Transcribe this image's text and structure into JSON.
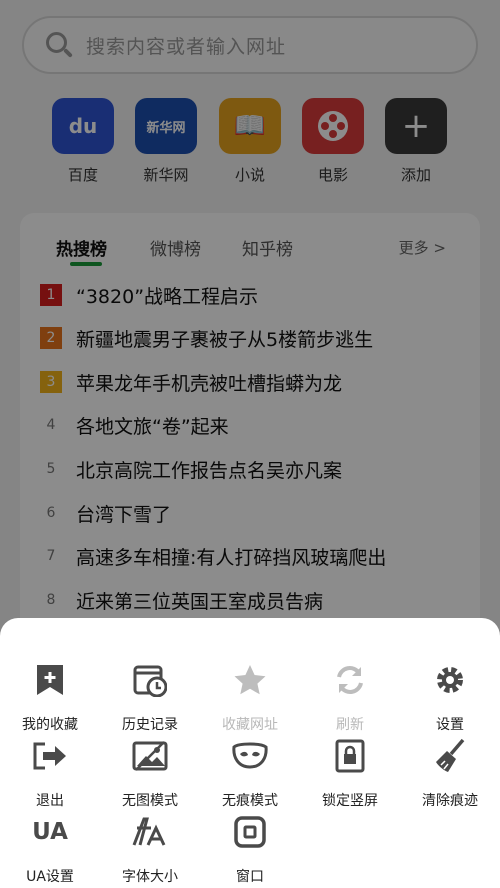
{
  "search": {
    "placeholder": "搜索内容或者输入网址"
  },
  "quick_links": [
    {
      "label": "百度",
      "icon": "baidu-icon",
      "color": "#2f55d4",
      "glyph": "du"
    },
    {
      "label": "新华网",
      "icon": "xinhua-icon",
      "color": "#1d4fb0",
      "glyph": "新华网"
    },
    {
      "label": "小说",
      "icon": "book-icon",
      "color": "#e6a21e",
      "glyph": "📖"
    },
    {
      "label": "电影",
      "icon": "film-icon",
      "color": "#d93b3b",
      "glyph": ""
    },
    {
      "label": "添加",
      "icon": "plus-icon",
      "color": "#3a3a3a",
      "glyph": "+"
    }
  ],
  "hot": {
    "tabs": [
      "热搜榜",
      "微博榜",
      "知乎榜"
    ],
    "more": "更多 >",
    "accent": "#1b9c3a",
    "items": [
      {
        "rank": "1",
        "text": "“3820”战略工程启示",
        "badge": "#d81e1e"
      },
      {
        "rank": "2",
        "text": "新疆地震男子裹被子从5楼箭步逃生",
        "badge": "#e8741c"
      },
      {
        "rank": "3",
        "text": "苹果龙年手机壳被吐槽指蟒为龙",
        "badge": "#f2b31b"
      },
      {
        "rank": "4",
        "text": "各地文旅“卷”起来",
        "badge": ""
      },
      {
        "rank": "5",
        "text": "北京高院工作报告点名吴亦凡案",
        "badge": ""
      },
      {
        "rank": "6",
        "text": "台湾下雪了",
        "badge": ""
      },
      {
        "rank": "7",
        "text": "高速多车相撞:有人打碎挡风玻璃爬出",
        "badge": ""
      },
      {
        "rank": "8",
        "text": "近来第三位英国王室成员告病",
        "badge": ""
      }
    ]
  },
  "menu": [
    {
      "label": "我的收藏",
      "icon": "bookmark-icon",
      "enabled": true
    },
    {
      "label": "历史记录",
      "icon": "history-icon",
      "enabled": true
    },
    {
      "label": "收藏网址",
      "icon": "star-icon",
      "enabled": false
    },
    {
      "label": "刷新",
      "icon": "refresh-icon",
      "enabled": false
    },
    {
      "label": "设置",
      "icon": "gear-icon",
      "enabled": true
    },
    {
      "label": "退出",
      "icon": "exit-icon",
      "enabled": true
    },
    {
      "label": "无图模式",
      "icon": "no-image-icon",
      "enabled": true
    },
    {
      "label": "无痕模式",
      "icon": "incognito-mask-icon",
      "enabled": true
    },
    {
      "label": "锁定竖屏",
      "icon": "lock-portrait-icon",
      "enabled": true
    },
    {
      "label": "清除痕迹",
      "icon": "broom-icon",
      "enabled": true
    },
    {
      "label": "UA设置",
      "icon": "ua-icon",
      "enabled": true,
      "glyph": "UA"
    },
    {
      "label": "字体大小",
      "icon": "font-size-icon",
      "enabled": true
    },
    {
      "label": "窗口",
      "icon": "window-icon",
      "enabled": true
    }
  ]
}
